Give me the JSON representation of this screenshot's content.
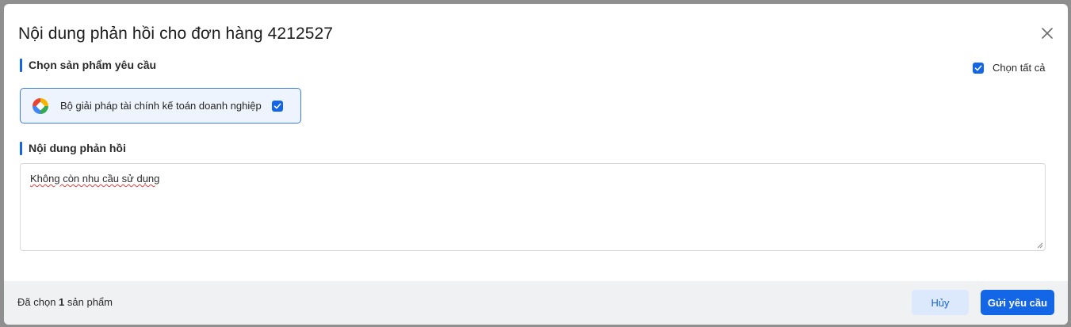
{
  "dialog": {
    "title": "Nội dung phản hồi cho đơn hàng 4212527",
    "close_icon": "close-icon"
  },
  "products_section": {
    "heading": "Chọn sản phẩm yêu cầu",
    "select_all_label": "Chọn tất cả",
    "select_all_checked": true,
    "items": [
      {
        "label": "Bộ giải pháp tài chính kế toán doanh nghiệp",
        "icon": "product-logo-icon",
        "checked": true
      }
    ]
  },
  "feedback_section": {
    "heading": "Nội dung phản hồi",
    "value": "Không còn nhu cầu sử dụng"
  },
  "footer": {
    "summary_prefix": "Đã chọn",
    "summary_count": "1",
    "summary_suffix": "sản phẩm",
    "cancel_label": "Hủy",
    "submit_label": "Gửi yêu cầu"
  },
  "colors": {
    "accent": "#1366e6",
    "card_bg": "#eef4fd",
    "cancel_bg": "#dce8fb",
    "footer_bg": "#f0f1f3"
  }
}
